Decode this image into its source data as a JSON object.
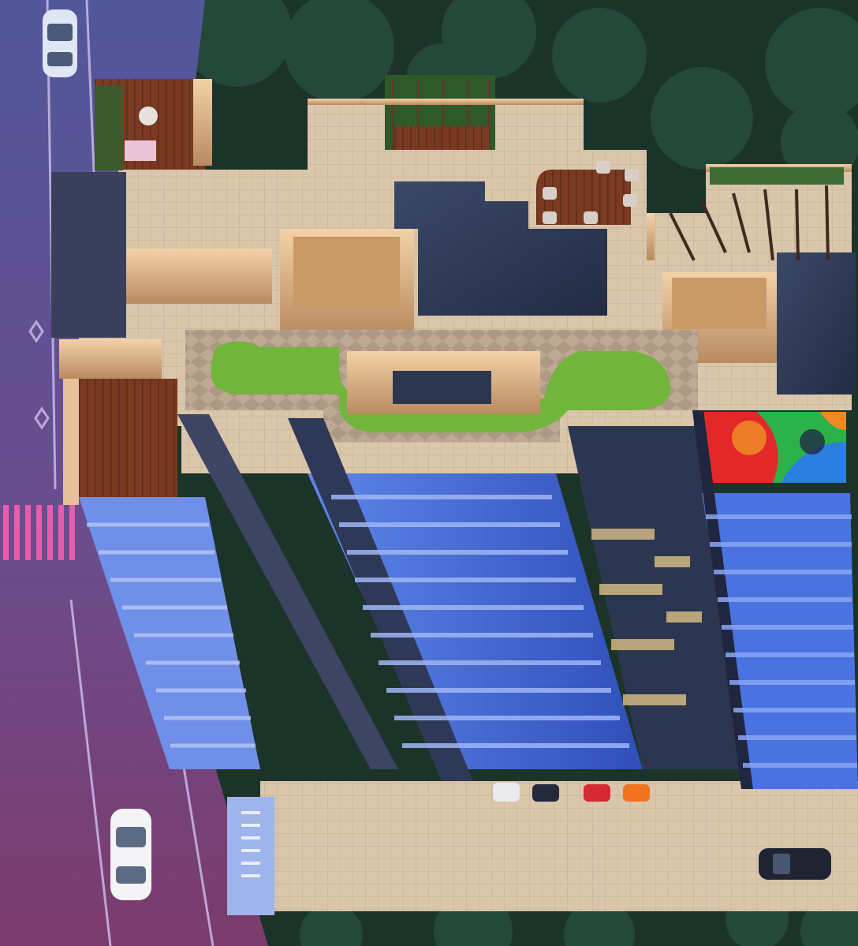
{
  "scene": {
    "kind": "aerial-architectural-render",
    "palette": {
      "road_top": "#5a5f9c",
      "road_bottom": "#7a3f70",
      "road_glow": "#ff4fa8",
      "foliage": "#1d3a2c",
      "terrace_floor": "#d8c3a8",
      "parapet": "#e6c19a",
      "lawn": "#6fb23b",
      "deck": "#7a3a22",
      "facade_blue": "#3f66d6",
      "facade_dark": "#2c3650",
      "shaft": "#34405e",
      "playground_red": "#e3282a",
      "playground_green": "#2bb34a",
      "playground_blue": "#2b7fe0",
      "playground_orange": "#f08a24",
      "paving": "#cdb79c"
    }
  }
}
